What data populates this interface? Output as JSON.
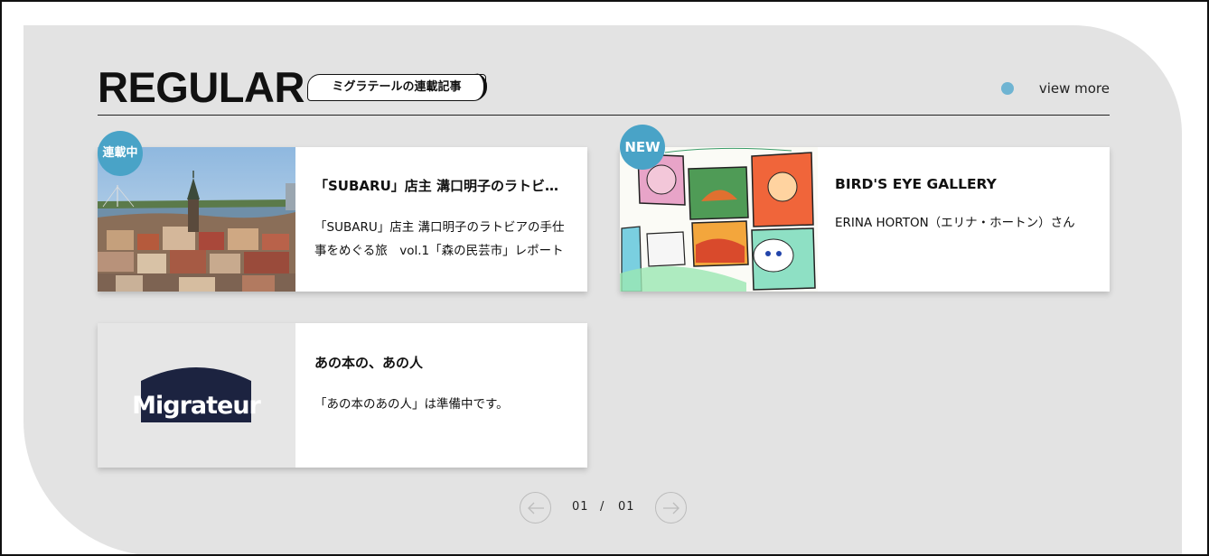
{
  "section": {
    "title": "REGULAR",
    "tag": "ミグラテールの連載記事",
    "view_more": "view more",
    "accent_color": "#49a3c7"
  },
  "cards": [
    {
      "badge": "連載中",
      "title": "「SUBARU」店主 溝口明子のラトビア手仕事をめぐる旅",
      "description": "「SUBARU」店主 溝口明子のラトビアの手仕事をめぐる旅　vol.1「森の民芸市」レポート",
      "image": "riga-cityscape-photo"
    },
    {
      "badge": "NEW",
      "title": "BIRD'S EYE GALLERY",
      "description": "ERINA HORTON（エリナ・ホートン）さん",
      "image": "colorful-comic-illustration"
    },
    {
      "badge": "",
      "title": "あの本の、あの人",
      "description": "「あの本のあの人」は準備中です。",
      "image": "migrateur-logo",
      "logo_text": "Migrateur"
    }
  ],
  "pagination": {
    "current": "01",
    "separator": "/",
    "total": "01"
  }
}
